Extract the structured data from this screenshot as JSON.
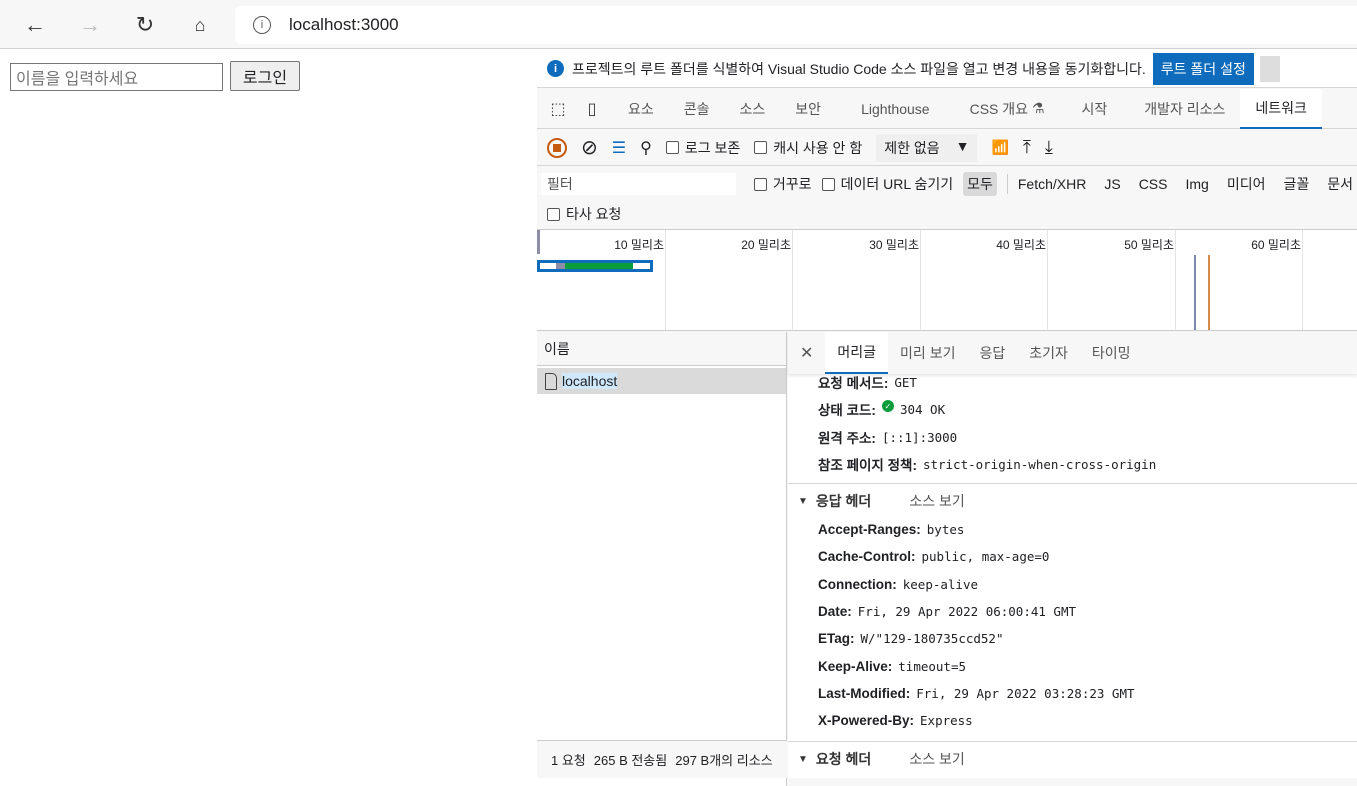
{
  "browser": {
    "url": "localhost:3000"
  },
  "page": {
    "name_placeholder": "이름을 입력하세요",
    "login_label": "로그인"
  },
  "devtools": {
    "infobar": {
      "message": "프로젝트의 루트 폴더를 식별하여 Visual Studio Code 소스 파일을 열고 변경 내용을 동기화합니다.",
      "button": "루트 폴더 설정"
    },
    "tabs": [
      "요소",
      "콘솔",
      "소스",
      "보안",
      "Lighthouse",
      "CSS 개요",
      "시작",
      "개발자 리소스",
      "네트워크"
    ],
    "toolbar": {
      "preserve_log": "로그 보존",
      "disable_cache": "캐시 사용 안 함",
      "throttle": "제한 없음"
    },
    "filter": {
      "placeholder": "필터",
      "invert": "거꾸로",
      "hide_data_urls": "데이터 URL 숨기기",
      "types": [
        "모두",
        "Fetch/XHR",
        "JS",
        "CSS",
        "Img",
        "미디어",
        "글꼴",
        "문서"
      ],
      "third_party": "타사 요청"
    },
    "timeline": {
      "ticks": [
        "10 밀리초",
        "20 밀리초",
        "30 밀리초",
        "40 밀리초",
        "50 밀리초",
        "60 밀리초"
      ],
      "colors": {
        "waiting": "#8d8da8",
        "download": "#0b9c3b",
        "dom": "#7b8aa8",
        "load": "#d38b4c"
      }
    },
    "requests": {
      "header": "이름",
      "items": [
        "localhost"
      ]
    },
    "footer": {
      "requests": "1 요청",
      "transferred": "265 B 전송됨",
      "resources": "297 B개의 리소스"
    },
    "detail": {
      "tabs": [
        "머리글",
        "미리 보기",
        "응답",
        "초기자",
        "타이밍"
      ],
      "general": [
        {
          "k": "요청 메서드:",
          "v": "GET"
        },
        {
          "k": "상태 코드:",
          "v": "304 OK"
        },
        {
          "k": "원격 주소:",
          "v": "[::1]:3000"
        },
        {
          "k": "참조 페이지 정책:",
          "v": "strict-origin-when-cross-origin"
        }
      ],
      "response_headers_title": "응답 헤더",
      "view_source": "소스 보기",
      "response_headers": [
        {
          "k": "Accept-Ranges:",
          "v": "bytes"
        },
        {
          "k": "Cache-Control:",
          "v": "public, max-age=0"
        },
        {
          "k": "Connection:",
          "v": "keep-alive"
        },
        {
          "k": "Date:",
          "v": "Fri, 29 Apr 2022 06:00:41 GMT"
        },
        {
          "k": "ETag:",
          "v": "W/\"129-180735ccd52\""
        },
        {
          "k": "Keep-Alive:",
          "v": "timeout=5"
        },
        {
          "k": "Last-Modified:",
          "v": "Fri, 29 Apr 2022 03:28:23 GMT"
        },
        {
          "k": "X-Powered-By:",
          "v": "Express"
        }
      ],
      "request_headers_title": "요청 헤더"
    },
    "accent": "#0f6cbd"
  }
}
